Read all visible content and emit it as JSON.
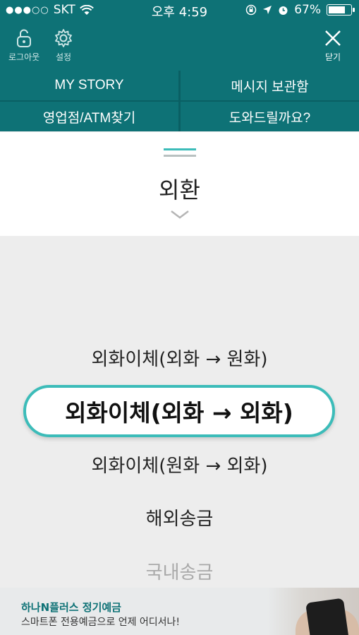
{
  "status_bar": {
    "carrier": "SKT",
    "time": "오후 4:59",
    "battery": "67%",
    "battery_level": 0.67
  },
  "header": {
    "logout_label": "로그아웃",
    "settings_label": "설정",
    "close_label": "닫기"
  },
  "menu_grid": [
    "MY STORY",
    "메시지 보관함",
    "영업점/ATM찾기",
    "도와드릴까요?"
  ],
  "section": {
    "title": "외환"
  },
  "picker": {
    "options": [
      "외화이체(외화 → 원화)",
      "외화이체(외화 → 외화)",
      "외화이체(원화 → 외화)",
      "해외송금",
      "국내송금"
    ],
    "selected_index": 1
  },
  "ad_banner": {
    "title": "하나N플러스 정기예금",
    "subtitle": "스마트폰 전용예금으로 언제 어디서나!"
  },
  "colors": {
    "brand_teal": "#0e7276",
    "accent_teal": "#3cbcb9"
  }
}
